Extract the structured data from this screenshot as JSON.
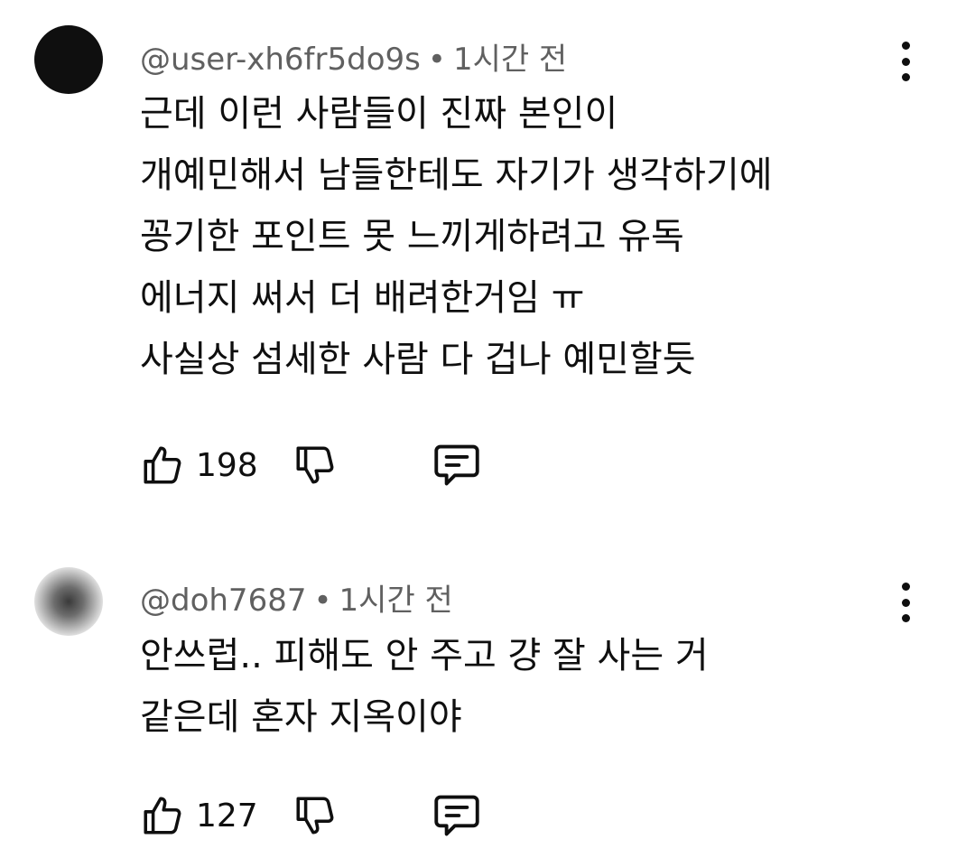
{
  "comments": [
    {
      "handle": "@user-xh6fr5do9s",
      "separator": "•",
      "time": "1시간 전",
      "lines": [
        "근데 이런 사람들이 진짜 본인이",
        "개예민해서 남들한테도 자기가 생각하기에",
        "꽁기한 포인트 못 느끼게하려고 유독",
        "에너지 써서 더 배려한거임 ㅠ",
        "사실상 섬세한 사람 다 겁나 예민할듯"
      ],
      "likes": "198",
      "avatar": "dark"
    },
    {
      "handle": "@doh7687",
      "separator": "•",
      "time": "1시간 전",
      "lines": [
        "안쓰럽.. 피해도 안 주고 걍 잘 사는 거",
        "같은데 혼자 지옥이야"
      ],
      "likes": "127",
      "avatar": "blurred"
    }
  ],
  "icons": {
    "like": "thumbs-up-icon",
    "dislike": "thumbs-down-icon",
    "reply": "reply-comment-icon",
    "menu": "vertical-ellipsis-icon"
  },
  "colors": {
    "text": "#0f0f0f",
    "secondary_text": "#606060",
    "background": "#ffffff"
  }
}
